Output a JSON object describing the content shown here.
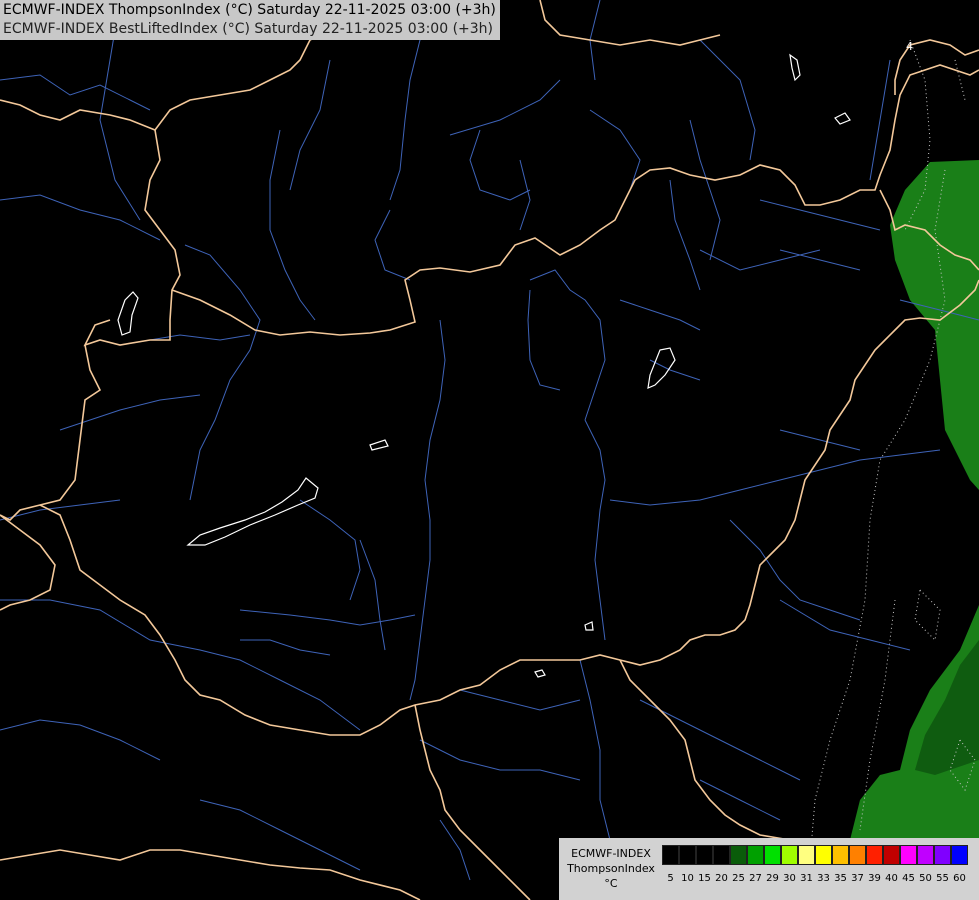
{
  "header": {
    "line1": "ECMWF-INDEX ThompsonIndex (°C) Saturday 22-11-2025 03:00 (+3h)",
    "line2": "ECMWF-INDEX BestLiftedIndex (°C) Saturday 22-11-2025 03:00 (+3h)"
  },
  "colors": {
    "background": "#000000",
    "borders": "#f3c89a",
    "rivers": "#3e63b8",
    "lakes": "#ffffff",
    "field_green": "#1a7f18",
    "field_green_dark": "#0f5c10"
  },
  "legend": {
    "line1": "ECMWF-INDEX",
    "line2": "ThompsonIndex",
    "line3": "°C",
    "colors": [
      "#000000",
      "#000000",
      "#000000",
      "#000000",
      "#0a5c0a",
      "#00a000",
      "#00e000",
      "#a0ff00",
      "#ffff80",
      "#ffff00",
      "#ffc000",
      "#ff8000",
      "#ff2000",
      "#c00000",
      "#ff00ff",
      "#c000ff",
      "#8000ff",
      "#0000ff"
    ],
    "ticks": [
      "5",
      "10",
      "15",
      "20",
      "25",
      "27",
      "29",
      "30",
      "31",
      "33",
      "35",
      "37",
      "39",
      "40",
      "45",
      "50",
      "55",
      "60"
    ]
  },
  "map_labels": {
    "isoline_label": "4"
  }
}
